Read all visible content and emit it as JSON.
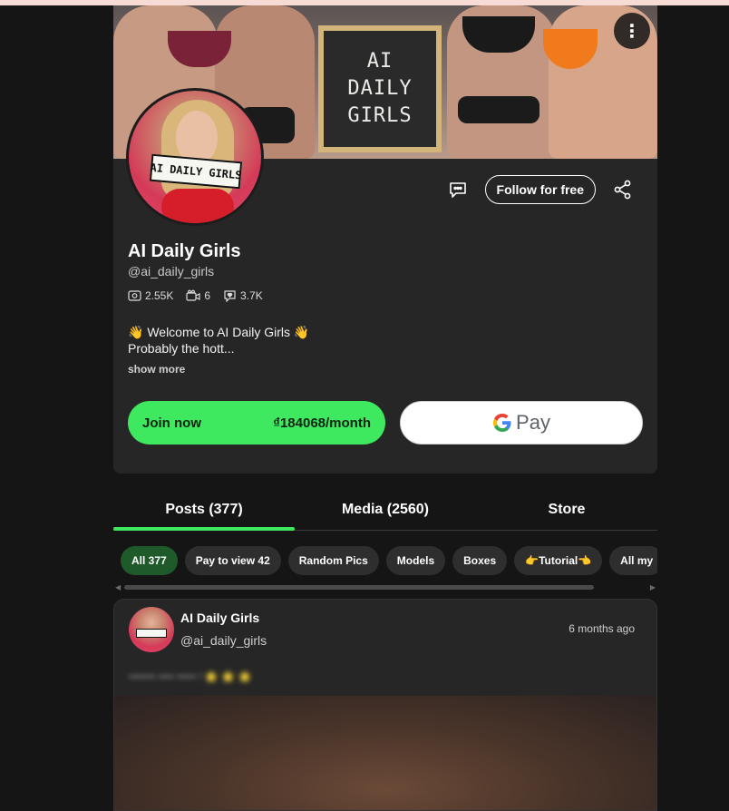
{
  "banner": {
    "sign_lines": [
      "AI",
      "DAILY",
      "GIRLS"
    ]
  },
  "profile": {
    "avatar_sign": "AI DAILY GIRLS",
    "name": "AI Daily Girls",
    "handle": "@ai_daily_girls",
    "stats": {
      "photos": "2.55K",
      "videos": "6",
      "likes": "3.7K"
    },
    "bio_line1": "👋 Welcome to AI Daily Girls 👋",
    "bio_line2": "Probably the hott...",
    "show_more": "show more",
    "follow_label": "Follow for free"
  },
  "subscribe": {
    "join_label": "Join now",
    "price": "₫184068/month",
    "gpay_label": "Pay"
  },
  "tabs": [
    {
      "label": "Posts (377)",
      "active": true
    },
    {
      "label": "Media (2560)",
      "active": false
    },
    {
      "label": "Store",
      "active": false
    }
  ],
  "chips": [
    {
      "label": "All 377",
      "active": true
    },
    {
      "label": "Pay to view 42",
      "active": false
    },
    {
      "label": "Random Pics",
      "active": false
    },
    {
      "label": "Models",
      "active": false
    },
    {
      "label": "Boxes",
      "active": false
    },
    {
      "label": "👉Tutorial👈",
      "active": false
    },
    {
      "label": "All my",
      "active": false
    }
  ],
  "post": {
    "author": "AI Daily Girls",
    "handle": "@ai_daily_girls",
    "time": "6 months ago",
    "blurred_text": "••••••• •••• ••••• ! ⭐ ⭐ ⭐"
  },
  "colors": {
    "accent": "#3ee85f",
    "background": "#151515",
    "card": "#262626"
  }
}
